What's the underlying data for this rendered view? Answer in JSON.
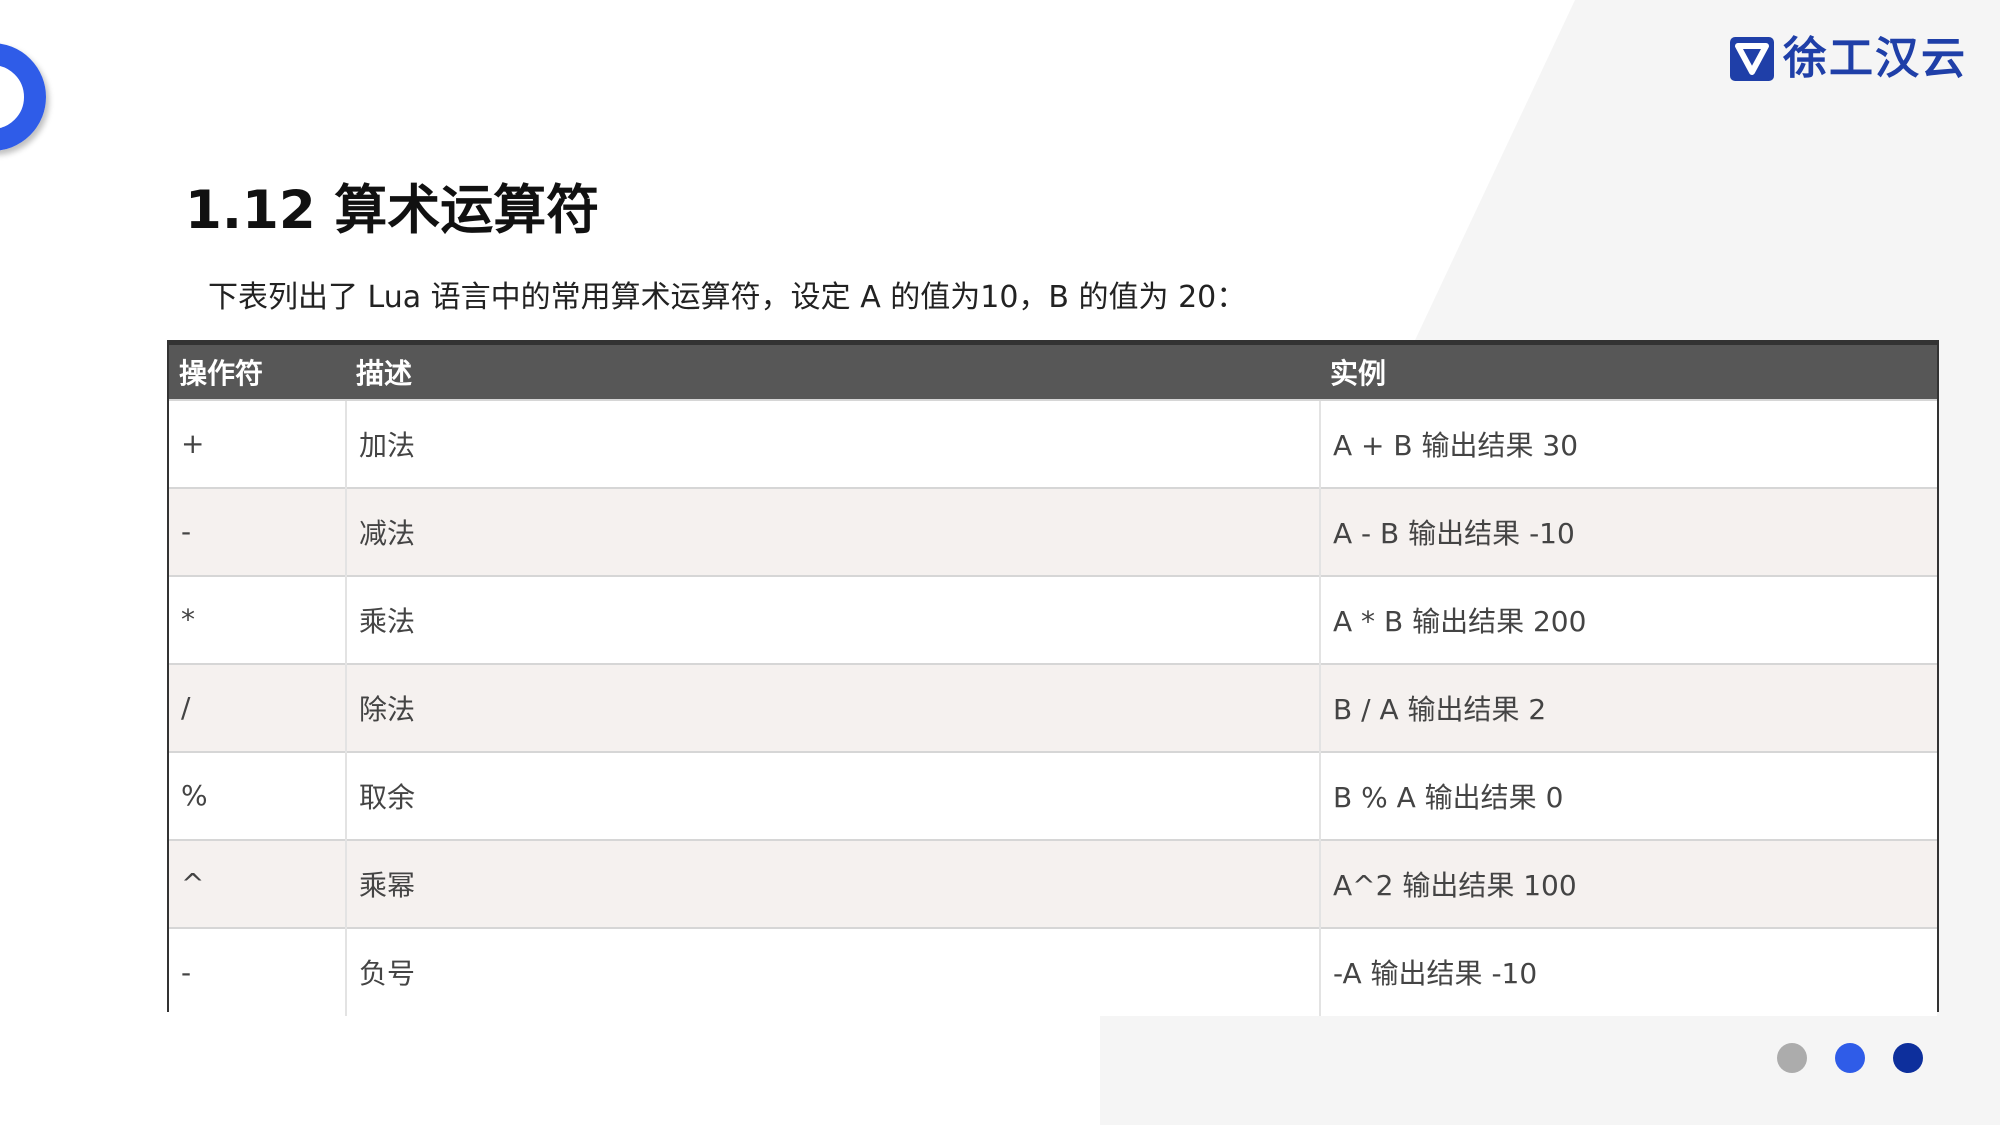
{
  "brand": {
    "name": "徐工汉云",
    "logo_icon": "xcmg-shield-logo",
    "color": "#1f3fa8"
  },
  "page": {
    "title": "1.12 算术运算符",
    "intro": "下表列出了 Lua 语言中的常用算术运算符，设定 A 的值为10，B 的值为 20："
  },
  "table": {
    "headers": [
      "操作符",
      "描述",
      "实例"
    ],
    "rows": [
      [
        "+",
        "加法",
        "A + B 输出结果 30"
      ],
      [
        "-",
        "减法",
        "A - B 输出结果 -10"
      ],
      [
        "*",
        "乘法",
        "A * B 输出结果 200"
      ],
      [
        "/",
        "除法",
        "B / A 输出结果 2"
      ],
      [
        "%",
        "取余",
        "B % A 输出结果 0"
      ],
      [
        "^",
        "乘幂",
        "A^2 输出结果 100"
      ],
      [
        "-",
        "负号",
        "-A 输出结果 -10"
      ]
    ],
    "header_bg": "#575757",
    "alt_row_bg": "#f5f1ef"
  },
  "decor": {
    "accent": "#2f5ce8",
    "dot_colors": [
      "#acacac",
      "#2f5ce8",
      "#0d2f9c"
    ]
  }
}
